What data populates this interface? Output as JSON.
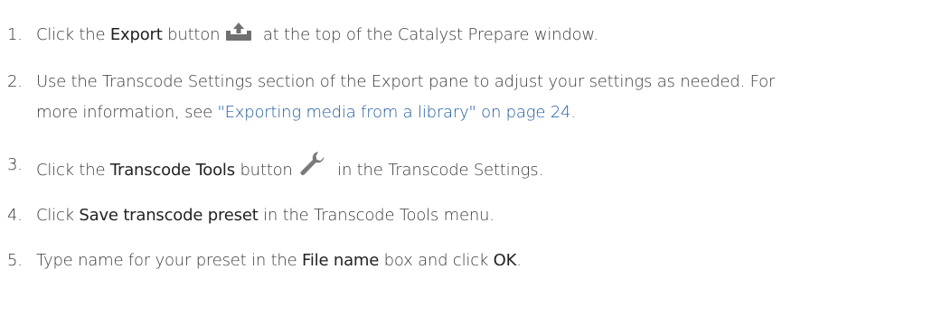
{
  "steps": [
    {
      "number": "1.",
      "pre": "Click the ",
      "bold": "Export",
      "mid": " button",
      "post": " at the top of the Catalyst Prepare window.",
      "icon": "export-icon"
    },
    {
      "number": "2.",
      "line1": "Use the Transcode Settings section of the Export pane to adjust your settings as needed. For",
      "line2_pre": "more information, see ",
      "link": "\"Exporting media from a library\" on page 24."
    },
    {
      "number": "3.",
      "pre": "Click the ",
      "bold": "Transcode Tools",
      "mid": " button",
      "post": " in the Transcode Settings.",
      "icon": "wrench-icon"
    },
    {
      "number": "4.",
      "pre": "Click ",
      "bold": "Save transcode preset",
      "post": " in the Transcode Tools menu."
    },
    {
      "number": "5.",
      "pre": "Type name for your preset in the ",
      "bold": "File name",
      "mid": " box and click ",
      "bold2": "OK",
      "post": "."
    }
  ],
  "colors": {
    "text": "#3a3a3a",
    "link": "#1f5a9c",
    "icon": "#6f6f6f"
  }
}
